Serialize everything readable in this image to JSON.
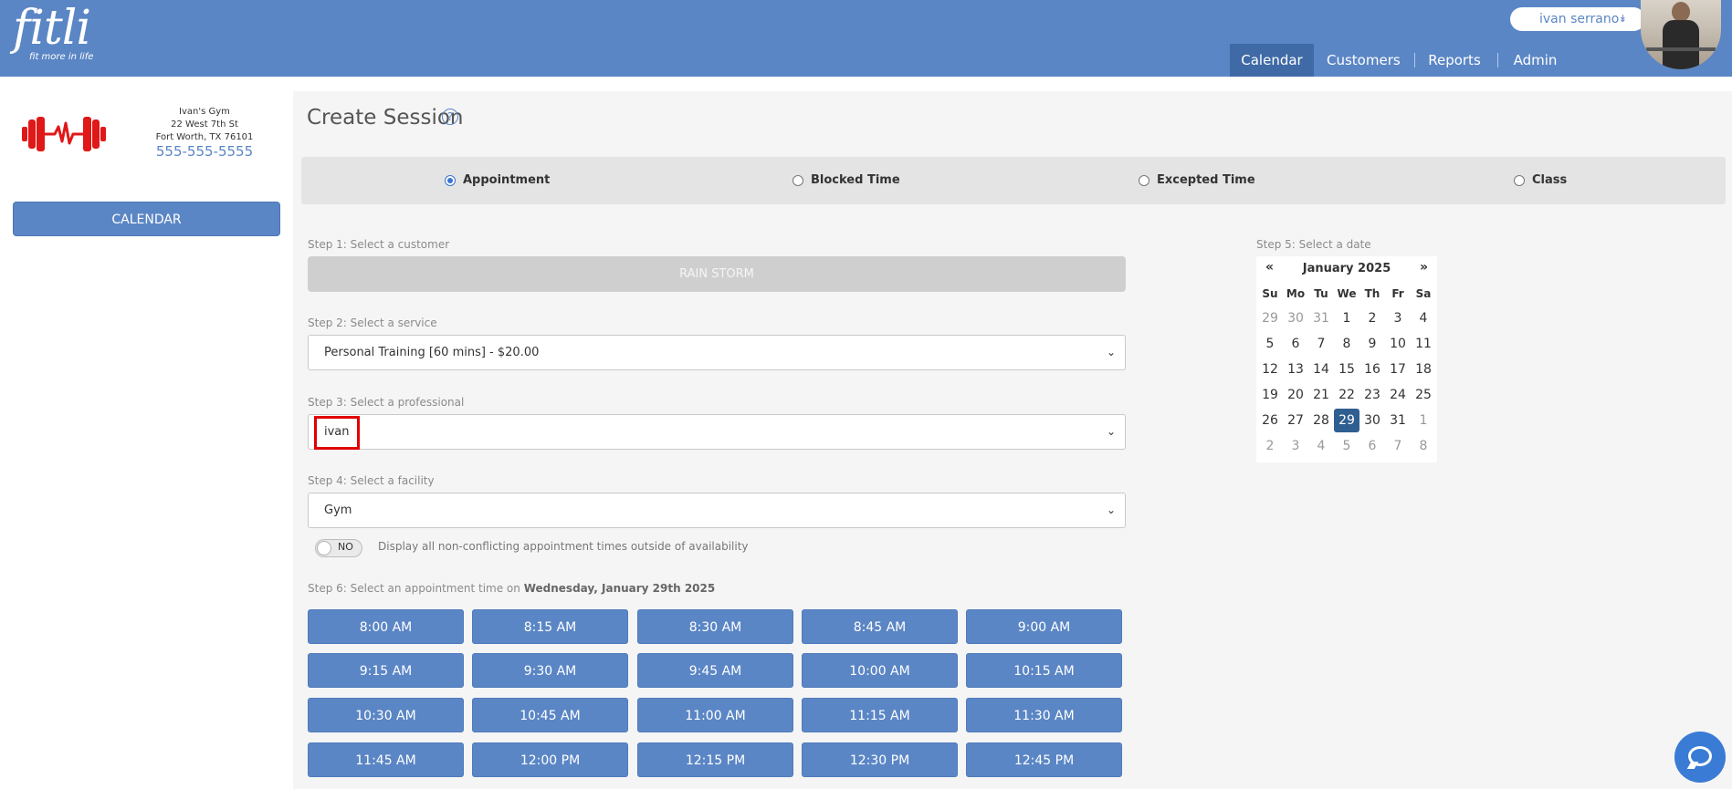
{
  "header": {
    "brand": "fitli",
    "tagline": "fit more in life",
    "user_name": "ivan serrano",
    "nav": [
      "Calendar",
      "Customers",
      "Reports",
      "Admin"
    ]
  },
  "sidebar": {
    "gym_name": "Ivan's Gym",
    "address1": "22 West 7th St",
    "address2": "Fort Worth, TX 76101",
    "phone": "555-555-5555",
    "calendar_button": "CALENDAR"
  },
  "main": {
    "title": "Create Session",
    "session_types": [
      "Appointment",
      "Blocked Time",
      "Excepted Time",
      "Class"
    ],
    "selected_type": "Appointment",
    "step1_label": "Step 1: Select a customer",
    "customer": "RAIN STORM",
    "step2_label": "Step 2: Select a service",
    "service": "Personal Training [60 mins] - $20.00",
    "step3_label": "Step 3: Select a professional",
    "professional": "ivan",
    "step4_label": "Step 4: Select a facility",
    "facility": "Gym",
    "toggle_value": "NO",
    "toggle_desc": "Display all non-conflicting appointment times outside of availability",
    "step5_label": "Step 5: Select a date",
    "step6_prefix": "Step 6: Select an appointment time on ",
    "step6_date": "Wednesday, January 29th 2025",
    "times": [
      "8:00 AM",
      "8:15 AM",
      "8:30 AM",
      "8:45 AM",
      "9:00 AM",
      "9:15 AM",
      "9:30 AM",
      "9:45 AM",
      "10:00 AM",
      "10:15 AM",
      "10:30 AM",
      "10:45 AM",
      "11:00 AM",
      "11:15 AM",
      "11:30 AM",
      "11:45 AM",
      "12:00 PM",
      "12:15 PM",
      "12:30 PM",
      "12:45 PM"
    ]
  },
  "calendar": {
    "prev": "«",
    "next": "»",
    "month_label": "January 2025",
    "days_of_week": [
      "Su",
      "Mo",
      "Tu",
      "We",
      "Th",
      "Fr",
      "Sa"
    ],
    "weeks": [
      [
        "29",
        "30",
        "31",
        "1",
        "2",
        "3",
        "4"
      ],
      [
        "5",
        "6",
        "7",
        "8",
        "9",
        "10",
        "11"
      ],
      [
        "12",
        "13",
        "14",
        "15",
        "16",
        "17",
        "18"
      ],
      [
        "19",
        "20",
        "21",
        "22",
        "23",
        "24",
        "25"
      ],
      [
        "26",
        "27",
        "28",
        "29",
        "30",
        "31",
        "1"
      ],
      [
        "2",
        "3",
        "4",
        "5",
        "6",
        "7",
        "8"
      ]
    ],
    "selected_day": "29"
  },
  "colors": {
    "brand_blue": "#5b86c5",
    "nav_active": "#3f6aa6",
    "calendar_selected": "#2f5e91",
    "highlight_red": "#e00000"
  },
  "icons": {
    "help": "question-circle-icon",
    "dropdown": "chevron-down-icon",
    "user_menu": "double-chevron-down-icon",
    "chat": "chat-bubble-icon",
    "gym_logo": "barbell-heartbeat-icon"
  }
}
